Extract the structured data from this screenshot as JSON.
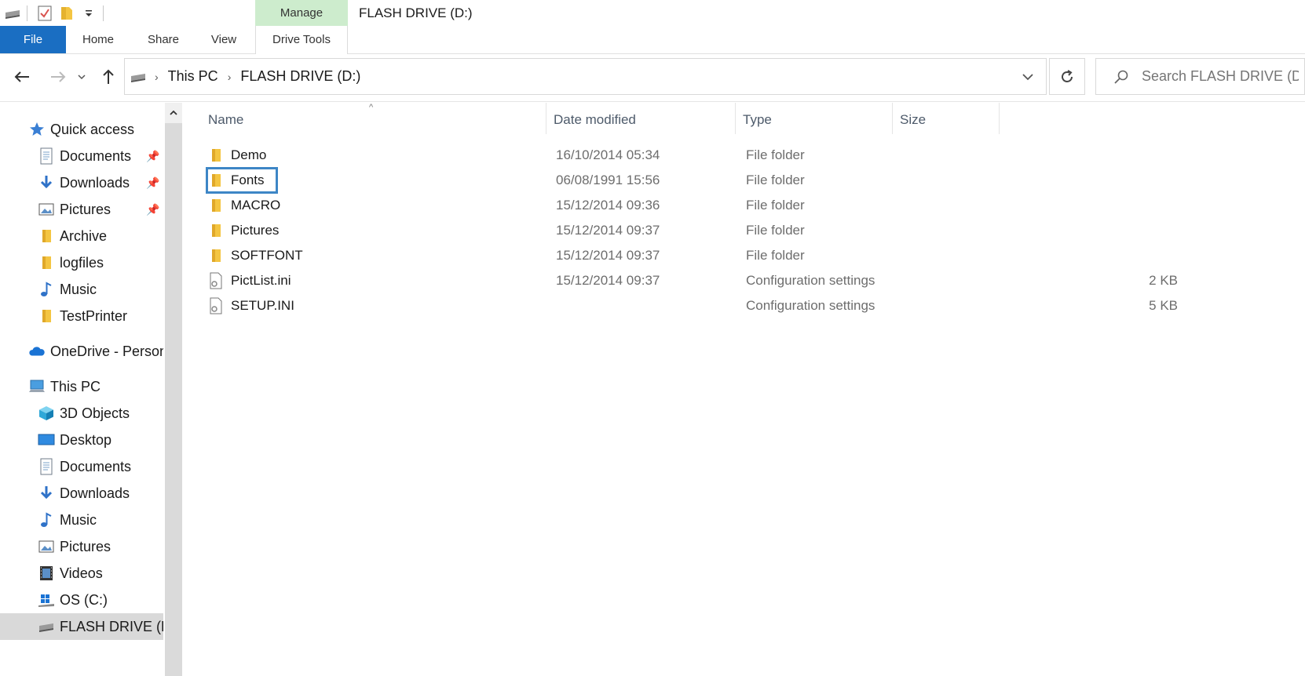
{
  "window": {
    "title": "FLASH DRIVE (D:)"
  },
  "ribbon": {
    "contextual_group": "Manage",
    "tabs": [
      {
        "label": "File"
      },
      {
        "label": "Home"
      },
      {
        "label": "Share"
      },
      {
        "label": "View"
      },
      {
        "label": "Drive Tools"
      }
    ]
  },
  "address": {
    "crumbs": [
      "This PC",
      "FLASH DRIVE (D:)"
    ]
  },
  "search": {
    "placeholder": "Search FLASH DRIVE (D:)"
  },
  "sidebar": {
    "items": [
      {
        "label": "Quick access",
        "icon": "star-icon"
      },
      {
        "label": "Documents",
        "icon": "documents-icon",
        "pinned": true
      },
      {
        "label": "Downloads",
        "icon": "downloads-icon",
        "pinned": true
      },
      {
        "label": "Pictures",
        "icon": "pictures-icon",
        "pinned": true
      },
      {
        "label": "Archive",
        "icon": "folder-icon"
      },
      {
        "label": "logfiles",
        "icon": "folder-icon"
      },
      {
        "label": "Music",
        "icon": "music-icon"
      },
      {
        "label": "TestPrinter",
        "icon": "folder-icon"
      },
      {
        "label": "OneDrive - Person",
        "icon": "onedrive-icon"
      },
      {
        "label": "This PC",
        "icon": "this-pc-icon"
      },
      {
        "label": "3D Objects",
        "icon": "3d-objects-icon"
      },
      {
        "label": "Desktop",
        "icon": "desktop-icon"
      },
      {
        "label": "Documents",
        "icon": "documents-icon"
      },
      {
        "label": "Downloads",
        "icon": "downloads-icon"
      },
      {
        "label": "Music",
        "icon": "music-icon"
      },
      {
        "label": "Pictures",
        "icon": "pictures-icon"
      },
      {
        "label": "Videos",
        "icon": "videos-icon"
      },
      {
        "label": "OS (C:)",
        "icon": "os-drive-icon"
      },
      {
        "label": "FLASH DRIVE (D",
        "icon": "flash-drive-icon"
      }
    ]
  },
  "columns": {
    "name": "Name",
    "date": "Date modified",
    "type": "Type",
    "size": "Size"
  },
  "files": [
    {
      "name": "Demo",
      "date": "16/10/2014 05:34",
      "type": "File folder",
      "size": "",
      "icon": "folder-icon"
    },
    {
      "name": "Fonts",
      "date": "06/08/1991 15:56",
      "type": "File folder",
      "size": "",
      "icon": "folder-icon"
    },
    {
      "name": "MACRO",
      "date": "15/12/2014 09:36",
      "type": "File folder",
      "size": "",
      "icon": "folder-icon"
    },
    {
      "name": "Pictures",
      "date": "15/12/2014 09:37",
      "type": "File folder",
      "size": "",
      "icon": "folder-icon"
    },
    {
      "name": "SOFTFONT",
      "date": "15/12/2014 09:37",
      "type": "File folder",
      "size": "",
      "icon": "folder-icon"
    },
    {
      "name": "PictList.ini",
      "date": "15/12/2014 09:37",
      "type": "Configuration settings",
      "size": "2 KB",
      "icon": "config-file-icon"
    },
    {
      "name": "SETUP.INI",
      "date": "",
      "type": "Configuration settings",
      "size": "5 KB",
      "icon": "config-file-icon"
    }
  ],
  "colors": {
    "accent": "#1a6ec2",
    "manage_tab": "#cdeccd",
    "folder": "#f4c542",
    "highlight": "#3d86c6"
  }
}
